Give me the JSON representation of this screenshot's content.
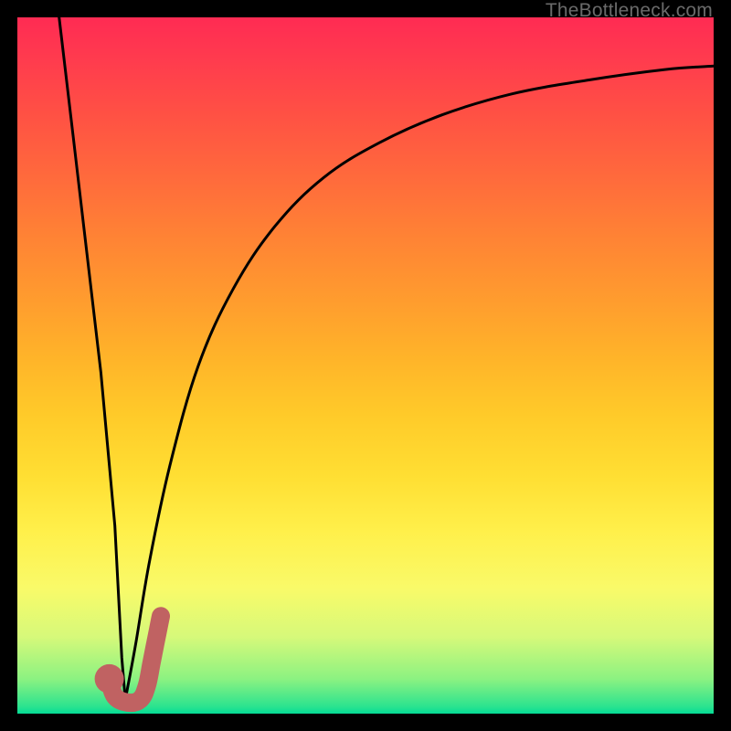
{
  "watermark": "TheBottleneck.com",
  "colors": {
    "frame": "#000000",
    "curve": "#000000",
    "marker": "#c06262",
    "gradient_top": "#ff2b53",
    "gradient_bottom": "#05dc95"
  },
  "chart_data": {
    "type": "line",
    "title": "",
    "xlabel": "",
    "ylabel": "",
    "xlim": [
      0,
      100
    ],
    "ylim": [
      0,
      100
    ],
    "series": [
      {
        "name": "left-branch",
        "x": [
          6,
          8,
          10,
          12,
          14,
          15,
          15.5
        ],
        "y": [
          100,
          83,
          66,
          49,
          27,
          8,
          2
        ]
      },
      {
        "name": "right-branch",
        "x": [
          15.5,
          17,
          19,
          22,
          26,
          31,
          37,
          44,
          52,
          61,
          71,
          82,
          93,
          100
        ],
        "y": [
          2,
          10,
          22,
          36,
          50,
          61,
          70,
          77,
          82,
          86,
          89,
          91,
          92.5,
          93
        ]
      }
    ],
    "marker": {
      "name": "j-marker",
      "shape": "J",
      "color": "#c06262",
      "points": [
        {
          "x": 13.2,
          "y": 5.0
        },
        {
          "x": 14.0,
          "y": 2.5
        },
        {
          "x": 15.8,
          "y": 1.6
        },
        {
          "x": 17.6,
          "y": 2.0
        },
        {
          "x": 18.6,
          "y": 4.0
        },
        {
          "x": 19.3,
          "y": 7.5
        },
        {
          "x": 20.0,
          "y": 11.0
        },
        {
          "x": 20.6,
          "y": 14.0
        }
      ],
      "dot": {
        "x": 13.2,
        "y": 5.0,
        "r": 2.1
      }
    }
  }
}
